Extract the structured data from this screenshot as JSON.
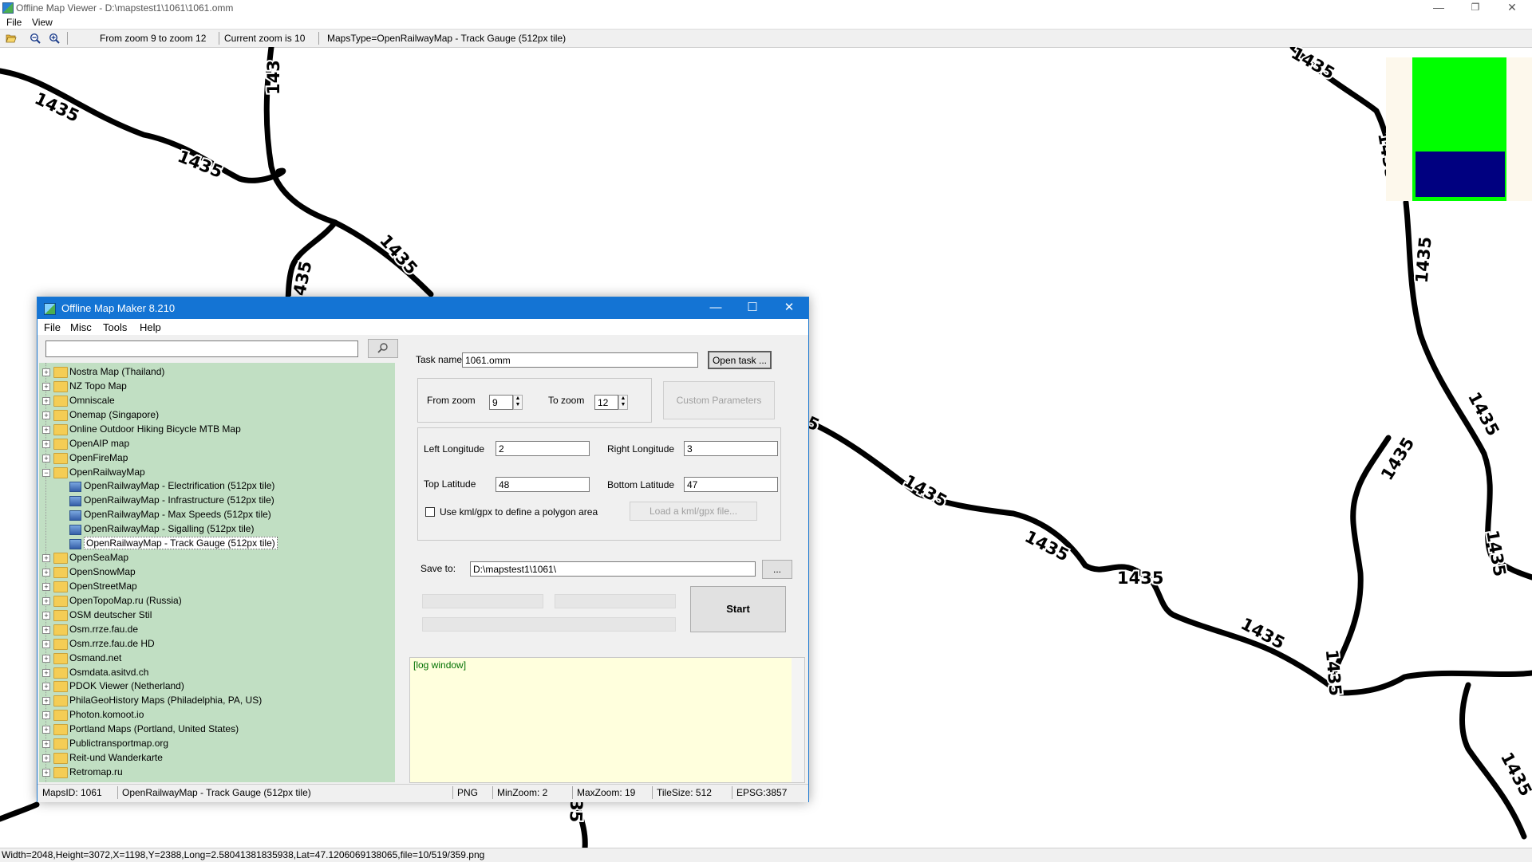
{
  "main_window": {
    "title": "Offline Map Viewer - D:\\mapstest1\\1061\\1061.omm",
    "menu": [
      "File",
      "View"
    ],
    "toolbar": {
      "open_icon": "folder-open-icon",
      "zoom_out_icon": "zoom-out-icon",
      "zoom_in_icon": "zoom-in-icon",
      "zoom_range": "From zoom 9 to zoom 12",
      "current_zoom": "Current zoom is 10",
      "maps_type": "MapsType=OpenRailwayMap - Track Gauge (512px tile)"
    },
    "status_bar": "Width=2048,Height=3072,X=1198,Y=2388,Long=2.58041381835938,Lat=47.1206069138065,file=10/519/359.png"
  },
  "map": {
    "gauge_label": "1435",
    "partial_labels": [
      "143",
      "5",
      "35"
    ],
    "overview_colors": {
      "outer": "#00ff00",
      "inner": "#000080"
    }
  },
  "dialog": {
    "title": "Offline Map Maker 8.210",
    "menu": [
      "File",
      "Misc",
      "Tools",
      "Help"
    ],
    "search": {
      "value": "",
      "button_icon": "search-icon"
    },
    "tree": [
      {
        "label": "Nostra Map (Thailand)",
        "level": 0,
        "expanded": false
      },
      {
        "label": "NZ Topo Map",
        "level": 0,
        "expanded": false
      },
      {
        "label": "Omniscale",
        "level": 0,
        "expanded": false
      },
      {
        "label": "Onemap (Singapore)",
        "level": 0,
        "expanded": false
      },
      {
        "label": "Online Outdoor Hiking Bicycle MTB Map",
        "level": 0,
        "expanded": false
      },
      {
        "label": "OpenAIP map",
        "level": 0,
        "expanded": false
      },
      {
        "label": "OpenFireMap",
        "level": 0,
        "expanded": false
      },
      {
        "label": "OpenRailwayMap",
        "level": 0,
        "expanded": true
      },
      {
        "label": "OpenRailwayMap - Electrification (512px tile)",
        "level": 1
      },
      {
        "label": "OpenRailwayMap - Infrastructure (512px tile)",
        "level": 1
      },
      {
        "label": "OpenRailwayMap - Max Speeds (512px tile)",
        "level": 1
      },
      {
        "label": "OpenRailwayMap - Sigalling (512px tile)",
        "level": 1
      },
      {
        "label": "OpenRailwayMap - Track Gauge (512px tile)",
        "level": 1,
        "selected": true
      },
      {
        "label": "OpenSeaMap",
        "level": 0,
        "expanded": false
      },
      {
        "label": "OpenSnowMap",
        "level": 0,
        "expanded": false
      },
      {
        "label": "OpenStreetMap",
        "level": 0,
        "expanded": false
      },
      {
        "label": "OpenTopoMap.ru (Russia)",
        "level": 0,
        "expanded": false
      },
      {
        "label": "OSM deutscher Stil",
        "level": 0,
        "expanded": false
      },
      {
        "label": "Osm.rrze.fau.de",
        "level": 0,
        "expanded": false
      },
      {
        "label": "Osm.rrze.fau.de HD",
        "level": 0,
        "expanded": false
      },
      {
        "label": "Osmand.net",
        "level": 0,
        "expanded": false
      },
      {
        "label": "Osmdata.asitvd.ch",
        "level": 0,
        "expanded": false
      },
      {
        "label": "PDOK Viewer (Netherland)",
        "level": 0,
        "expanded": false
      },
      {
        "label": "PhilaGeoHistory Maps (Philadelphia, PA, US)",
        "level": 0,
        "expanded": false
      },
      {
        "label": "Photon.komoot.io",
        "level": 0,
        "expanded": false
      },
      {
        "label": "Portland Maps (Portland, United States)",
        "level": 0,
        "expanded": false
      },
      {
        "label": "Publictransportmap.org",
        "level": 0,
        "expanded": false
      },
      {
        "label": "Reit-und Wanderkarte",
        "level": 0,
        "expanded": false
      },
      {
        "label": "Retromap.ru",
        "level": 0,
        "expanded": false
      }
    ],
    "form": {
      "task_name_label": "Task name",
      "task_name_value": "1061.omm",
      "open_task_button": "Open task ...",
      "from_zoom_label": "From zoom",
      "from_zoom_value": "9",
      "to_zoom_label": "To zoom",
      "to_zoom_value": "12",
      "custom_params_button": "Custom Parameters",
      "left_lon_label": "Left Longitude",
      "left_lon_value": "2",
      "right_lon_label": "Right Longitude",
      "right_lon_value": "3",
      "top_lat_label": "Top Latitude",
      "top_lat_value": "48",
      "bottom_lat_label": "Bottom Latitude",
      "bottom_lat_value": "47",
      "kml_checkbox_label": "Use kml/gpx to define a polygon area",
      "kml_checked": false,
      "load_kml_button": "Load a kml/gpx file...",
      "save_to_label": "Save to:",
      "save_to_value": "D:\\mapstest1\\1061\\",
      "browse_button": "...",
      "start_button": "Start"
    },
    "log": "[log window]",
    "status": {
      "maps_id": "MapsID: 1061",
      "map_name": "OpenRailwayMap - Track Gauge (512px tile)",
      "format": "PNG",
      "min_zoom": "MinZoom: 2",
      "max_zoom": "MaxZoom: 19",
      "tile_size": "TileSize: 512",
      "epsg": "EPSG:3857"
    }
  }
}
